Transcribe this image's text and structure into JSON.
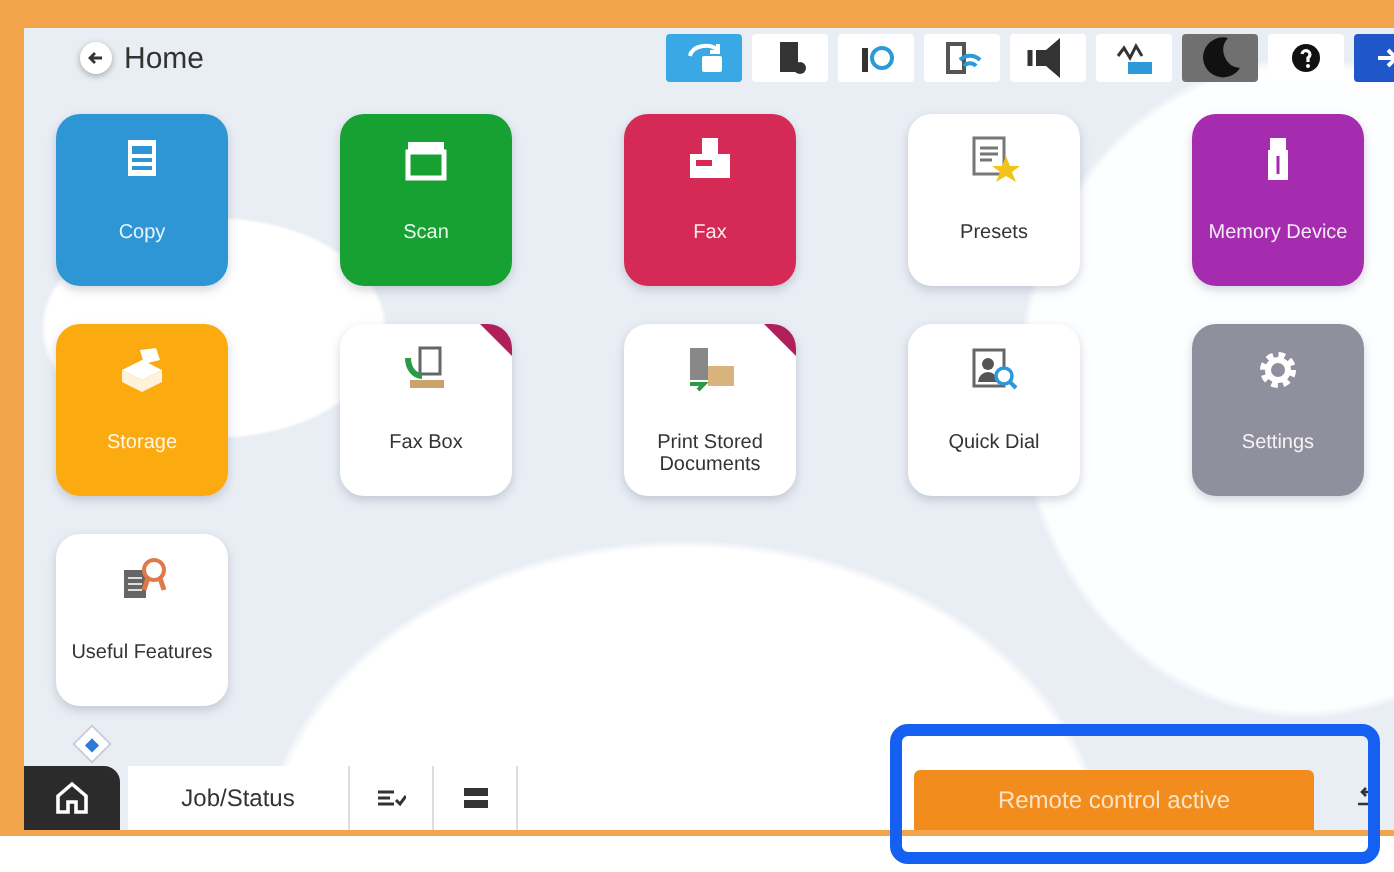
{
  "header": {
    "back_label": "Home"
  },
  "status_buttons": [
    {
      "selected": true
    },
    {
      "selected": false
    },
    {
      "selected": false
    },
    {
      "selected": false
    },
    {
      "selected": false
    },
    {
      "selected": false
    },
    {
      "selected": true
    },
    {
      "selected": false
    },
    {
      "selected": true
    }
  ],
  "tiles": [
    {
      "label": "Copy",
      "color": "#2f96d6",
      "flagged": false
    },
    {
      "label": "Scan",
      "color": "#16a132",
      "flagged": false
    },
    {
      "label": "Fax",
      "color": "#d42a55",
      "flagged": false
    },
    {
      "label": "Presets",
      "color": "#ffffff",
      "flagged": false
    },
    {
      "label": "Memory Device",
      "color": "#a52cae",
      "flagged": false
    },
    {
      "label": "Storage",
      "color": "#fbaa10",
      "flagged": false
    },
    {
      "label": "Fax Box",
      "color": "#ffffff",
      "flagged": true
    },
    {
      "label": "Print Stored Documents",
      "color": "#ffffff",
      "flagged": true
    },
    {
      "label": "Quick Dial",
      "color": "#ffffff",
      "flagged": false
    },
    {
      "label": "Settings",
      "color": "#8f8f9e",
      "flagged": false
    },
    {
      "label": "Useful Features",
      "color": "#ffffff",
      "flagged": false
    }
  ],
  "bottom_bar": {
    "tab_label": "Job/Status",
    "remote_button": "Remote control active"
  }
}
